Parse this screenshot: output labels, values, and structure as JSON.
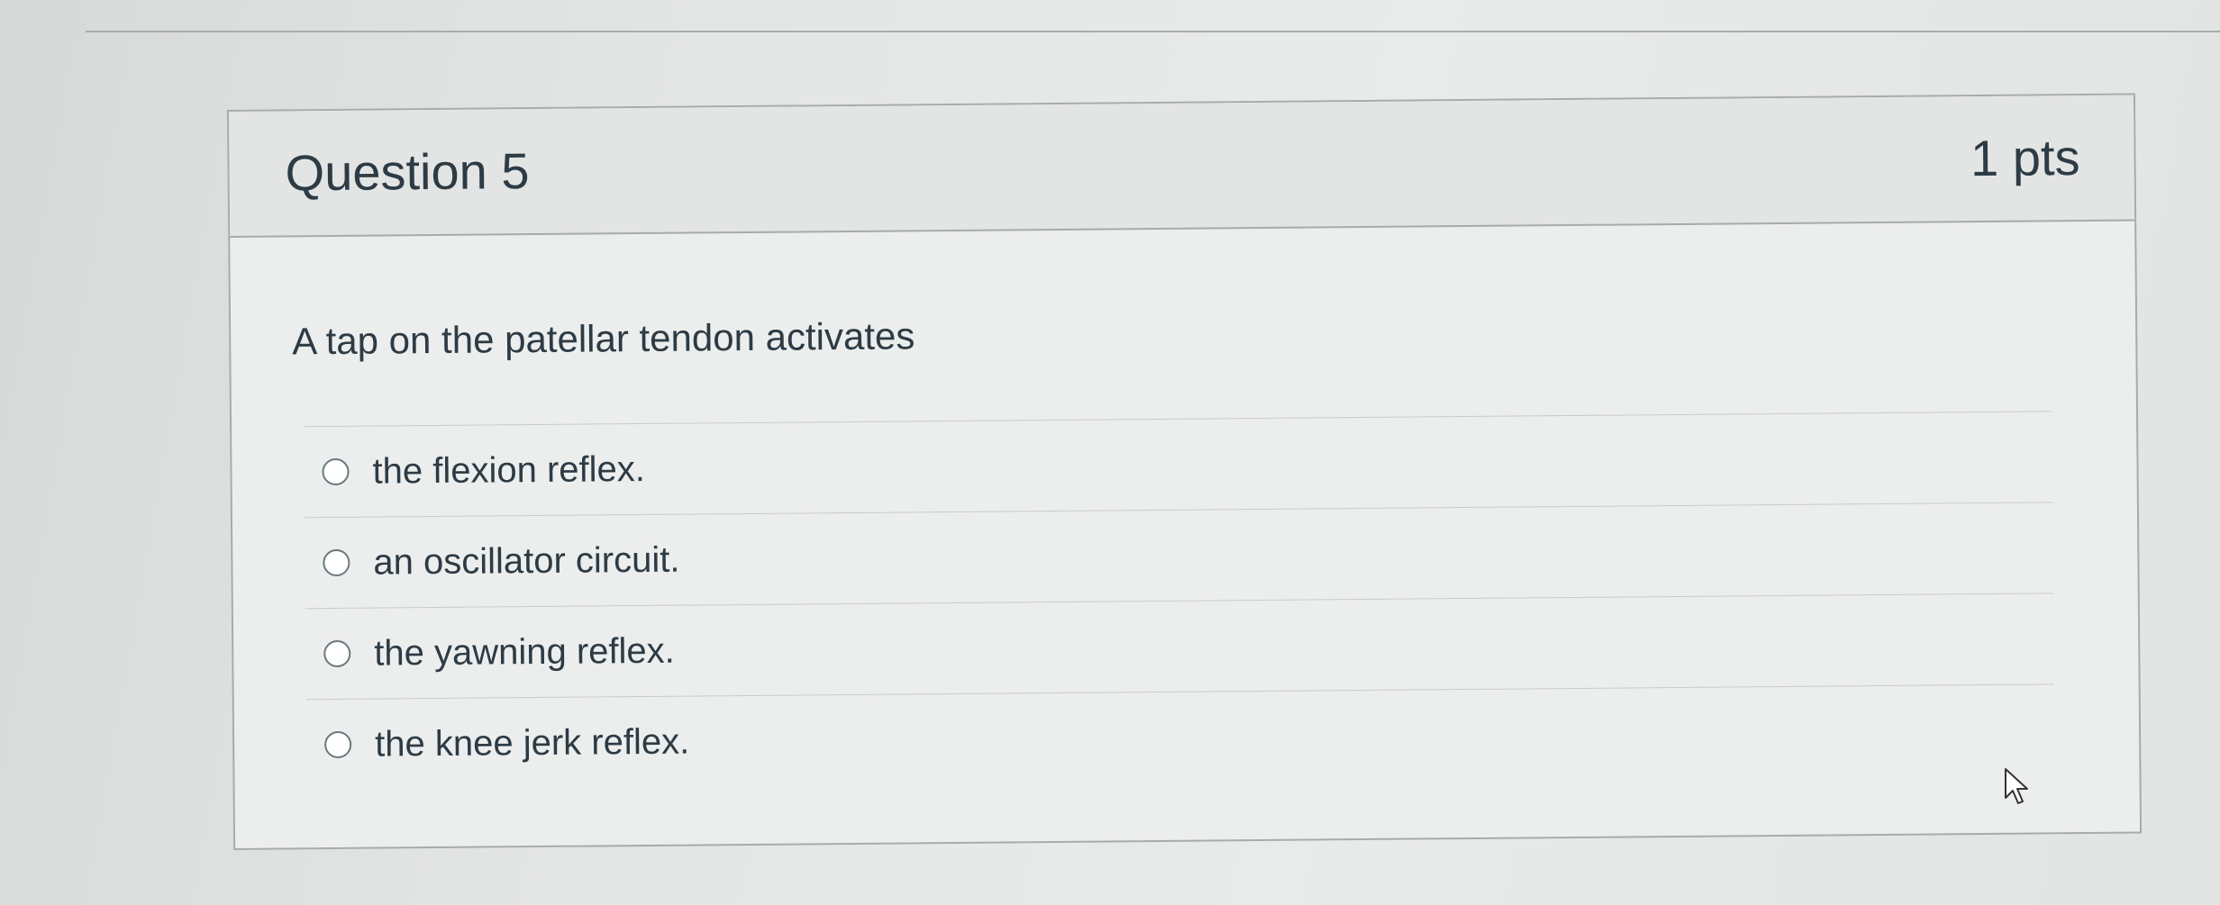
{
  "question": {
    "title": "Question 5",
    "points": "1 pts",
    "text": "A tap on the patellar tendon activates",
    "answers": [
      {
        "label": "the flexion reflex.",
        "selected": false
      },
      {
        "label": "an oscillator circuit.",
        "selected": false
      },
      {
        "label": "the yawning reflex.",
        "selected": false
      },
      {
        "label": "the knee jerk reflex.",
        "selected": false
      }
    ]
  },
  "icons": {
    "radio": "radio-button-icon",
    "cursor": "mouse-pointer-icon"
  },
  "colors": {
    "text": "#2d3b45",
    "border": "#a7abaa",
    "header_bg": "#e3e5e4"
  }
}
